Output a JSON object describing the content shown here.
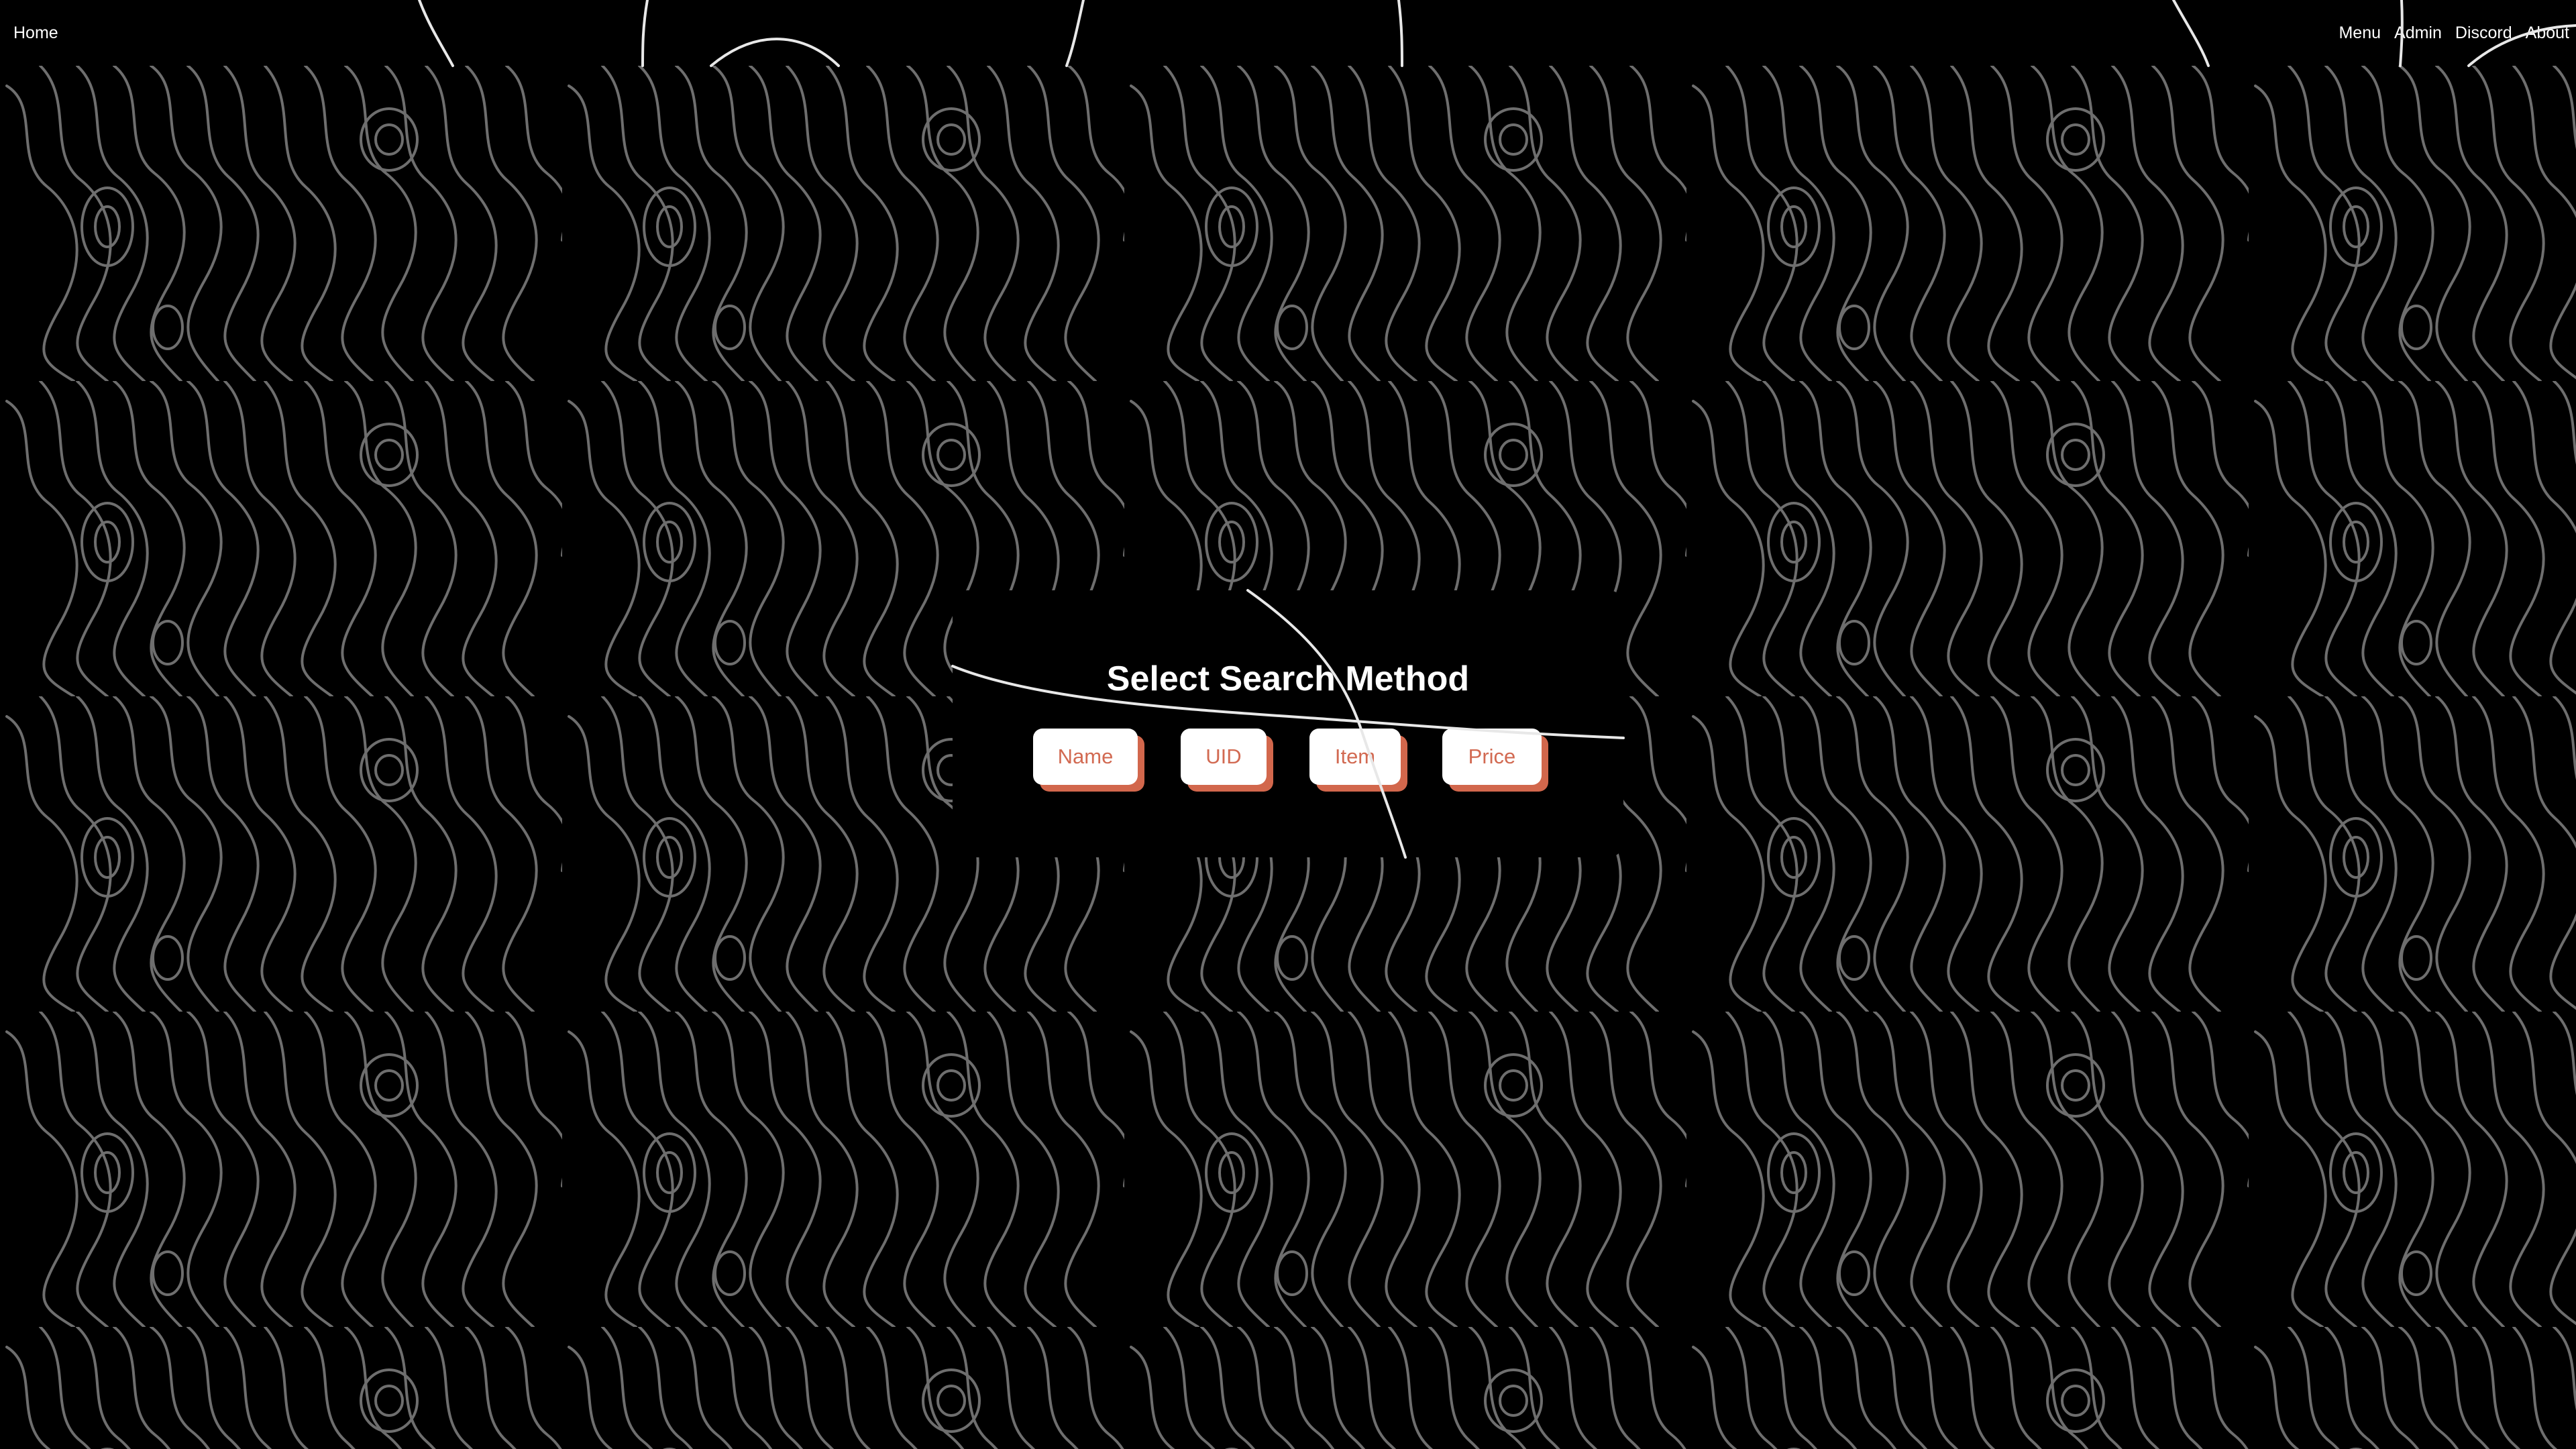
{
  "nav": {
    "home": "Home",
    "menu": "Menu",
    "admin": "Admin",
    "discord": "Discord",
    "about": "About"
  },
  "search": {
    "title": "Select Search Method",
    "buttons": {
      "name": "Name",
      "uid": "UID",
      "item": "Item",
      "price": "Price"
    }
  },
  "colors": {
    "background": "#000000",
    "accent": "#d2674c",
    "button_text": "#d26a52",
    "contour_lines": "#6e6e6e"
  }
}
